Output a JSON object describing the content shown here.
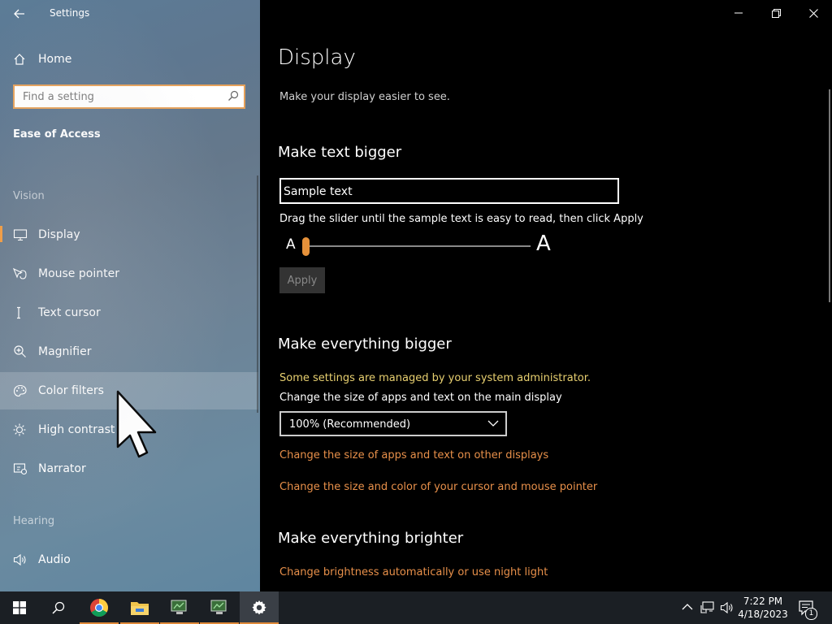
{
  "window": {
    "title": "Settings"
  },
  "sidebar": {
    "home_label": "Home",
    "search_placeholder": "Find a setting",
    "section_title": "Ease of Access",
    "groups": {
      "vision": "Vision",
      "hearing": "Hearing"
    },
    "items": [
      {
        "label": "Display",
        "icon": "monitor-icon",
        "selected": true
      },
      {
        "label": "Mouse pointer",
        "icon": "mouse-pointer-icon"
      },
      {
        "label": "Text cursor",
        "icon": "text-cursor-icon"
      },
      {
        "label": "Magnifier",
        "icon": "magnifier-icon"
      },
      {
        "label": "Color filters",
        "icon": "palette-icon",
        "hovered": true
      },
      {
        "label": "High contrast",
        "icon": "sun-icon"
      },
      {
        "label": "Narrator",
        "icon": "narrator-icon"
      },
      {
        "label": "Audio",
        "icon": "speaker-icon"
      }
    ]
  },
  "main": {
    "title": "Display",
    "subtitle": "Make your display easier to see.",
    "text_bigger": {
      "heading": "Make text bigger",
      "sample_text": "Sample text",
      "hint": "Drag the slider until the sample text is easy to read, then click Apply",
      "slider_min_label": "A",
      "slider_max_label": "A",
      "slider_value_percent": 0,
      "apply_label": "Apply"
    },
    "everything_bigger": {
      "heading": "Make everything bigger",
      "admin_notice": "Some settings are managed by your system administrator.",
      "size_label": "Change the size of apps and text on the main display",
      "size_value": "100% (Recommended)",
      "link_other_displays": "Change the size of apps and text on other displays",
      "link_cursor": "Change the size and color of your cursor and mouse pointer"
    },
    "everything_brighter": {
      "heading": "Make everything brighter",
      "link_brightness": "Change brightness automatically or use night light"
    }
  },
  "taskbar": {
    "time": "7:22 PM",
    "date": "4/18/2023",
    "notification_count": "1",
    "accent": "#e08a3a"
  },
  "colors": {
    "accent": "#f39a3c",
    "link": "#e8904a",
    "admin_notice": "#e8d070"
  }
}
